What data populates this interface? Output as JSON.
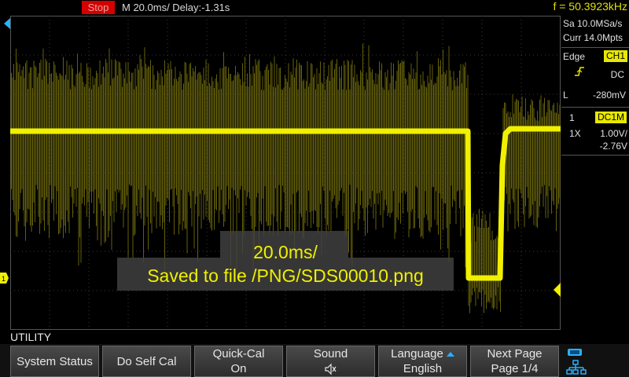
{
  "status": {
    "run_state": "Stop",
    "timebase": "M 20.0ms/ Delay:-1.31s",
    "frequency": "f = 50.3923kHz"
  },
  "acquisition": {
    "sample_rate": "Sa 10.0MSa/s",
    "memory_depth": "Curr 14.0Mpts"
  },
  "trigger": {
    "type": "Edge",
    "source": "CH1",
    "coupling": "DC",
    "level_label": "L",
    "level": "-280mV"
  },
  "channel": {
    "number": "1",
    "coupling": "DC1M",
    "probe": "1X",
    "scale": "1.00V/",
    "offset": "-2.76V"
  },
  "markers": {
    "ch1_marker": "1"
  },
  "osd": {
    "line1": "20.0ms/",
    "line2": "Saved to file /PNG/SDS00010.png"
  },
  "menu": {
    "title": "UTILITY",
    "buttons": [
      {
        "line1": "System Status"
      },
      {
        "line1": "Do Self Cal"
      },
      {
        "line1": "Quick-Cal",
        "line2": "On"
      },
      {
        "line1": "Sound",
        "icon": "speaker-icon"
      },
      {
        "line1": "Language",
        "line2": "English",
        "icon": "arrow-up-icon"
      },
      {
        "line1": "Next Page",
        "line2": "Page 1/4"
      }
    ]
  },
  "colors": {
    "trace": "#f0f000",
    "trace_dim": "#6e6a0c",
    "stop": "#d40000",
    "grid": "#3a3a3a",
    "accent_blue": "#2ab0ff"
  }
}
